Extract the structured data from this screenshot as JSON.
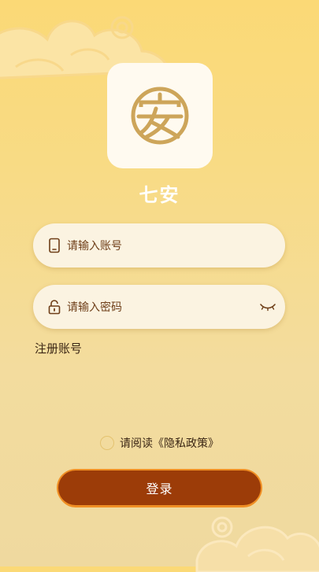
{
  "app": {
    "name": "七安"
  },
  "form": {
    "account_placeholder": "请输入账号",
    "password_placeholder": "请输入密码",
    "register_label": "注册账号"
  },
  "policy": {
    "text": "请阅读《隐私政策》",
    "checked": false
  },
  "login": {
    "label": "登录"
  },
  "colors": {
    "background_top": "#fbd976",
    "background_bottom": "#efd99f",
    "field_bg": "#fbf3e1",
    "button_bg": "#9c3c08",
    "button_border": "#f08f24",
    "logo_gold": "#cda55a"
  },
  "icons": {
    "logo": "coin-an-logo",
    "account": "phone-icon",
    "password": "lock-icon",
    "visibility": "eye-closed-icon"
  }
}
